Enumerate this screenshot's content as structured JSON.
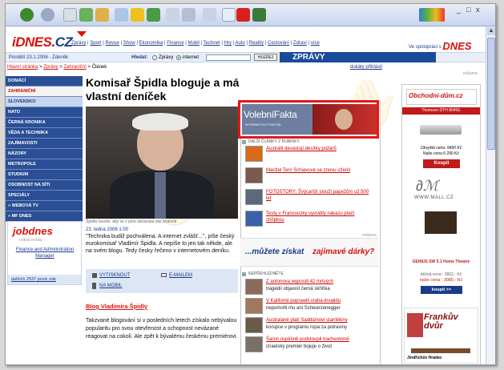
{
  "window": {
    "min": "_",
    "max": "□",
    "close": "x"
  },
  "site": {
    "logo_i": "iDNES",
    "logo_cz": ".CZ",
    "partner_label": "Ve spolupráci s",
    "partner_brand": "DNES"
  },
  "topnav": [
    "Zprávy",
    "Sport",
    "Revue",
    "Show",
    "Ekonomika",
    "Finance",
    "Mobil",
    "Technet",
    "Hry",
    "Auto",
    "Reality",
    "Cestování",
    "Zdraví",
    "více"
  ],
  "datebar": {
    "date": "Pondělí 23.1.2006 - Zdeněk",
    "search_label": "Hledat:",
    "opt_news": "Zprávy",
    "opt_web": "internet",
    "search_button": "HLEDEJ",
    "section": "ZPRÁVY",
    "login": "dukáty přihlásit"
  },
  "breadcrumb": {
    "home": "Hlavní stránka",
    "zpravy": "Zprávy",
    "zahranicni": "Zahraniční",
    "current": "Článek"
  },
  "sidebar": [
    {
      "label": "DOMÁCÍ"
    },
    {
      "label": "ZAHRANIČNÍ"
    },
    {
      "label": "SLOVENSKO"
    },
    {
      "label": "NATO"
    },
    {
      "label": "ČERNÁ KRONIKA"
    },
    {
      "label": "VĚDA A TECHNIKA"
    },
    {
      "label": "ZAJÍMAVOSTI"
    },
    {
      "label": "NÁZORY"
    },
    {
      "label": "METROPOLE"
    },
    {
      "label": "STUDIUM"
    },
    {
      "label": "OSOBNOST NA SÍTI"
    },
    {
      "label": "SPECIÁLY"
    },
    {
      "label": "» WEBOVÁ TV"
    },
    {
      "label": "» MF DNES"
    }
  ],
  "jobdnes": {
    "brand": "jobdnes",
    "sub": "volná místa",
    "link1": "Finance and Administration Manager",
    "bottom": "dalších 2537 pozic zde"
  },
  "article": {
    "title": "Komisař Špidla bloguje a má vlastní deníček",
    "photo_caption": "Špidla neučte, aby se z jeho občánska stal ztrávník",
    "date": "23. ledna 2006 1:00",
    "lead": "\"Technika budiž pochválena. A internet zvlášť...\", píše český eurokomisař Vladimír Špidla. A nepíše to jen tak někde, ale na svém blogu. Tedy česky řečeno v internetovém deníku.",
    "tool_print": "VYTISKNOUT",
    "tool_email": "E-MAILEM",
    "tool_mobile": "NA MOBIL",
    "blog_link": "Blog Vladimíra Špidly",
    "body": "Takzvané blogování si v posledních letech získalo nebývalou popularitu pro svou otevřenost a schopnost nevázané reagovat na cokoli. Ale zpět k bývalému českému premiérovi."
  },
  "ad_vf": {
    "brand": "VolebníFakta",
    "sub": "INTERNETOVÝ PORTÁL"
  },
  "stories_head": "DALŠÍ ČLÁNKY Z RUBRIKY",
  "stories": [
    {
      "title": "Austrálii devastují desítky požárů"
    },
    {
      "title": "Manžel Terri Schiavové se znovu oženil"
    },
    {
      "title": "FOTOSTORY: Švýcarští slouží papežům už 500 let"
    },
    {
      "title": "Testy v Francouzky vyvrátily nákazu ptačí chřipkou"
    }
  ],
  "promo": {
    "text": "...můžete získat",
    "em": "zajímavé dárky?",
    "reklama": "reklama"
  },
  "notmiss_head": "NEPŘEHLÉDNĚTE",
  "notmiss": [
    {
      "title": "Z antonova wypostil 42 mrtvých",
      "sub": "tragédií objasnil černá skříňka"
    },
    {
      "title": "V Kalifornii poprawili vraha-invalidu",
      "sub": "nepomohl mu ani Schwarzenegger"
    },
    {
      "title": "Australané platí Saddámovi stamilióny",
      "sub": "korupce v programu ropa za potraviny"
    },
    {
      "title": "Šaron úspěšně podstoupil tracheotomii",
      "sub": "izraelský premiér bojuje o život"
    }
  ],
  "right": {
    "reklama": "reklama",
    "ad1_brand": "Obchodní-dům.cz",
    "ad1_product": "Thomson DTH 8045E",
    "ad1_price_old": "Obvyklá cena: 9490 Kč",
    "ad1_price_new": "Naše cena 6 290 Kč",
    "ad1_buy": "Koupit",
    "ad2_brand": "WWW.MALL.CZ",
    "ad2_product": "GENIUS SW 5.1 Home Theatre",
    "ad2_price_old": "běžná cena : 3862,- Kč",
    "ad2_price_new": "naše cena : 3080,- Kč",
    "ad2_buy": "koupit >>",
    "ad3_brand": "Frankův dvůr",
    "ad3_city": "Jindřichův Hradec"
  }
}
